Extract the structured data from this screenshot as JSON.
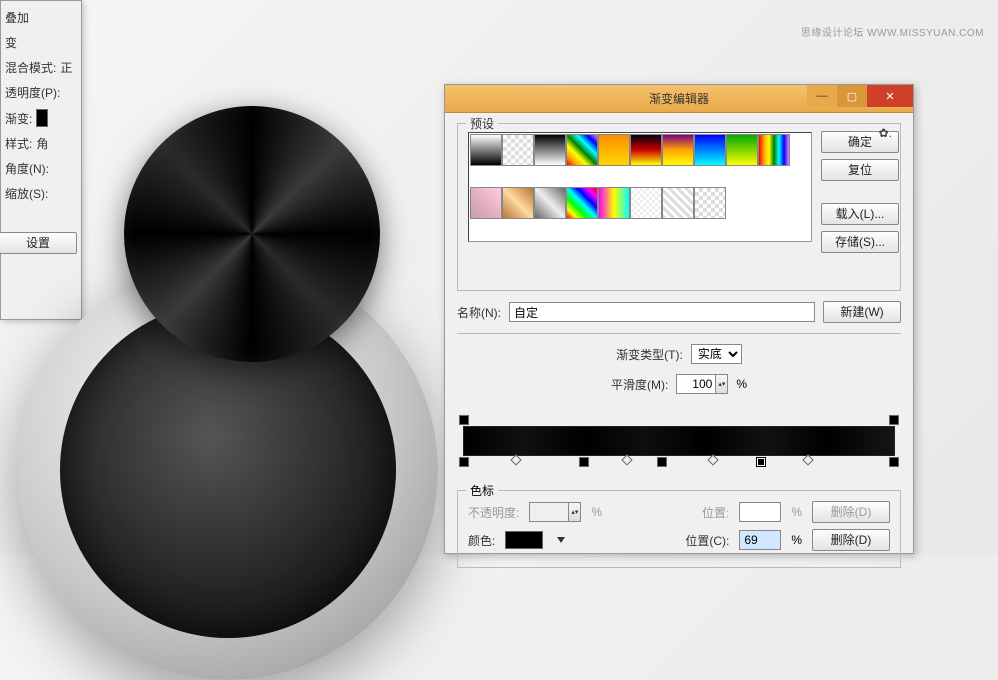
{
  "watermark": "思缘设计论坛  WWW.MISSYUAN.COM",
  "dialog": {
    "title": "渐变编辑器",
    "presets_label": "预设",
    "buttons": {
      "ok": "确定",
      "reset": "复位",
      "load": "载入(L)...",
      "save": "存储(S)...",
      "new": "新建(W)"
    },
    "name_label": "名称(N):",
    "name_value": "自定",
    "gradtype_label": "渐变类型(T):",
    "gradtype_value": "实底",
    "smoothness_label": "平滑度(M):",
    "smoothness_value": "100",
    "percent": "%",
    "stops": {
      "legend": "色标",
      "opacity_label": "不透明度:",
      "opacity_value": "",
      "position_label": "位置:",
      "position_value": "",
      "delete": "删除(D)",
      "color_label": "颜色:",
      "location_label": "位置(C):",
      "location_value": "69",
      "delete2": "删除(D)"
    },
    "min": "—",
    "max": "▢",
    "close": "✕"
  },
  "panel2": {
    "overlay": "叠加",
    "gradient": "变",
    "blend_label": "混合模式:",
    "blend_value": "正",
    "opacity_label": "透明度(P):",
    "grad_label": "渐变:",
    "style_label": "样式:",
    "style_value": "角",
    "angle_label": "角度(N):",
    "scale_label": "缩放(S):",
    "set_button": "设置"
  },
  "chart_data": {
    "type": "gradient",
    "smoothness_percent": 100,
    "color_stops": [
      {
        "position": 0,
        "color": "#000000"
      },
      {
        "position": 14,
        "color": "#111111"
      },
      {
        "position": 28,
        "color": "#000000"
      },
      {
        "position": 42,
        "color": "#0e0e0e"
      },
      {
        "position": 56,
        "color": "#000000"
      },
      {
        "position": 69,
        "color": "#121212",
        "selected": true
      },
      {
        "position": 84,
        "color": "#000000"
      },
      {
        "position": 100,
        "color": "#151515"
      }
    ],
    "opacity_stops": [
      {
        "position": 0,
        "opacity": 100
      },
      {
        "position": 100,
        "opacity": 100
      }
    ],
    "selected_location": 69
  }
}
